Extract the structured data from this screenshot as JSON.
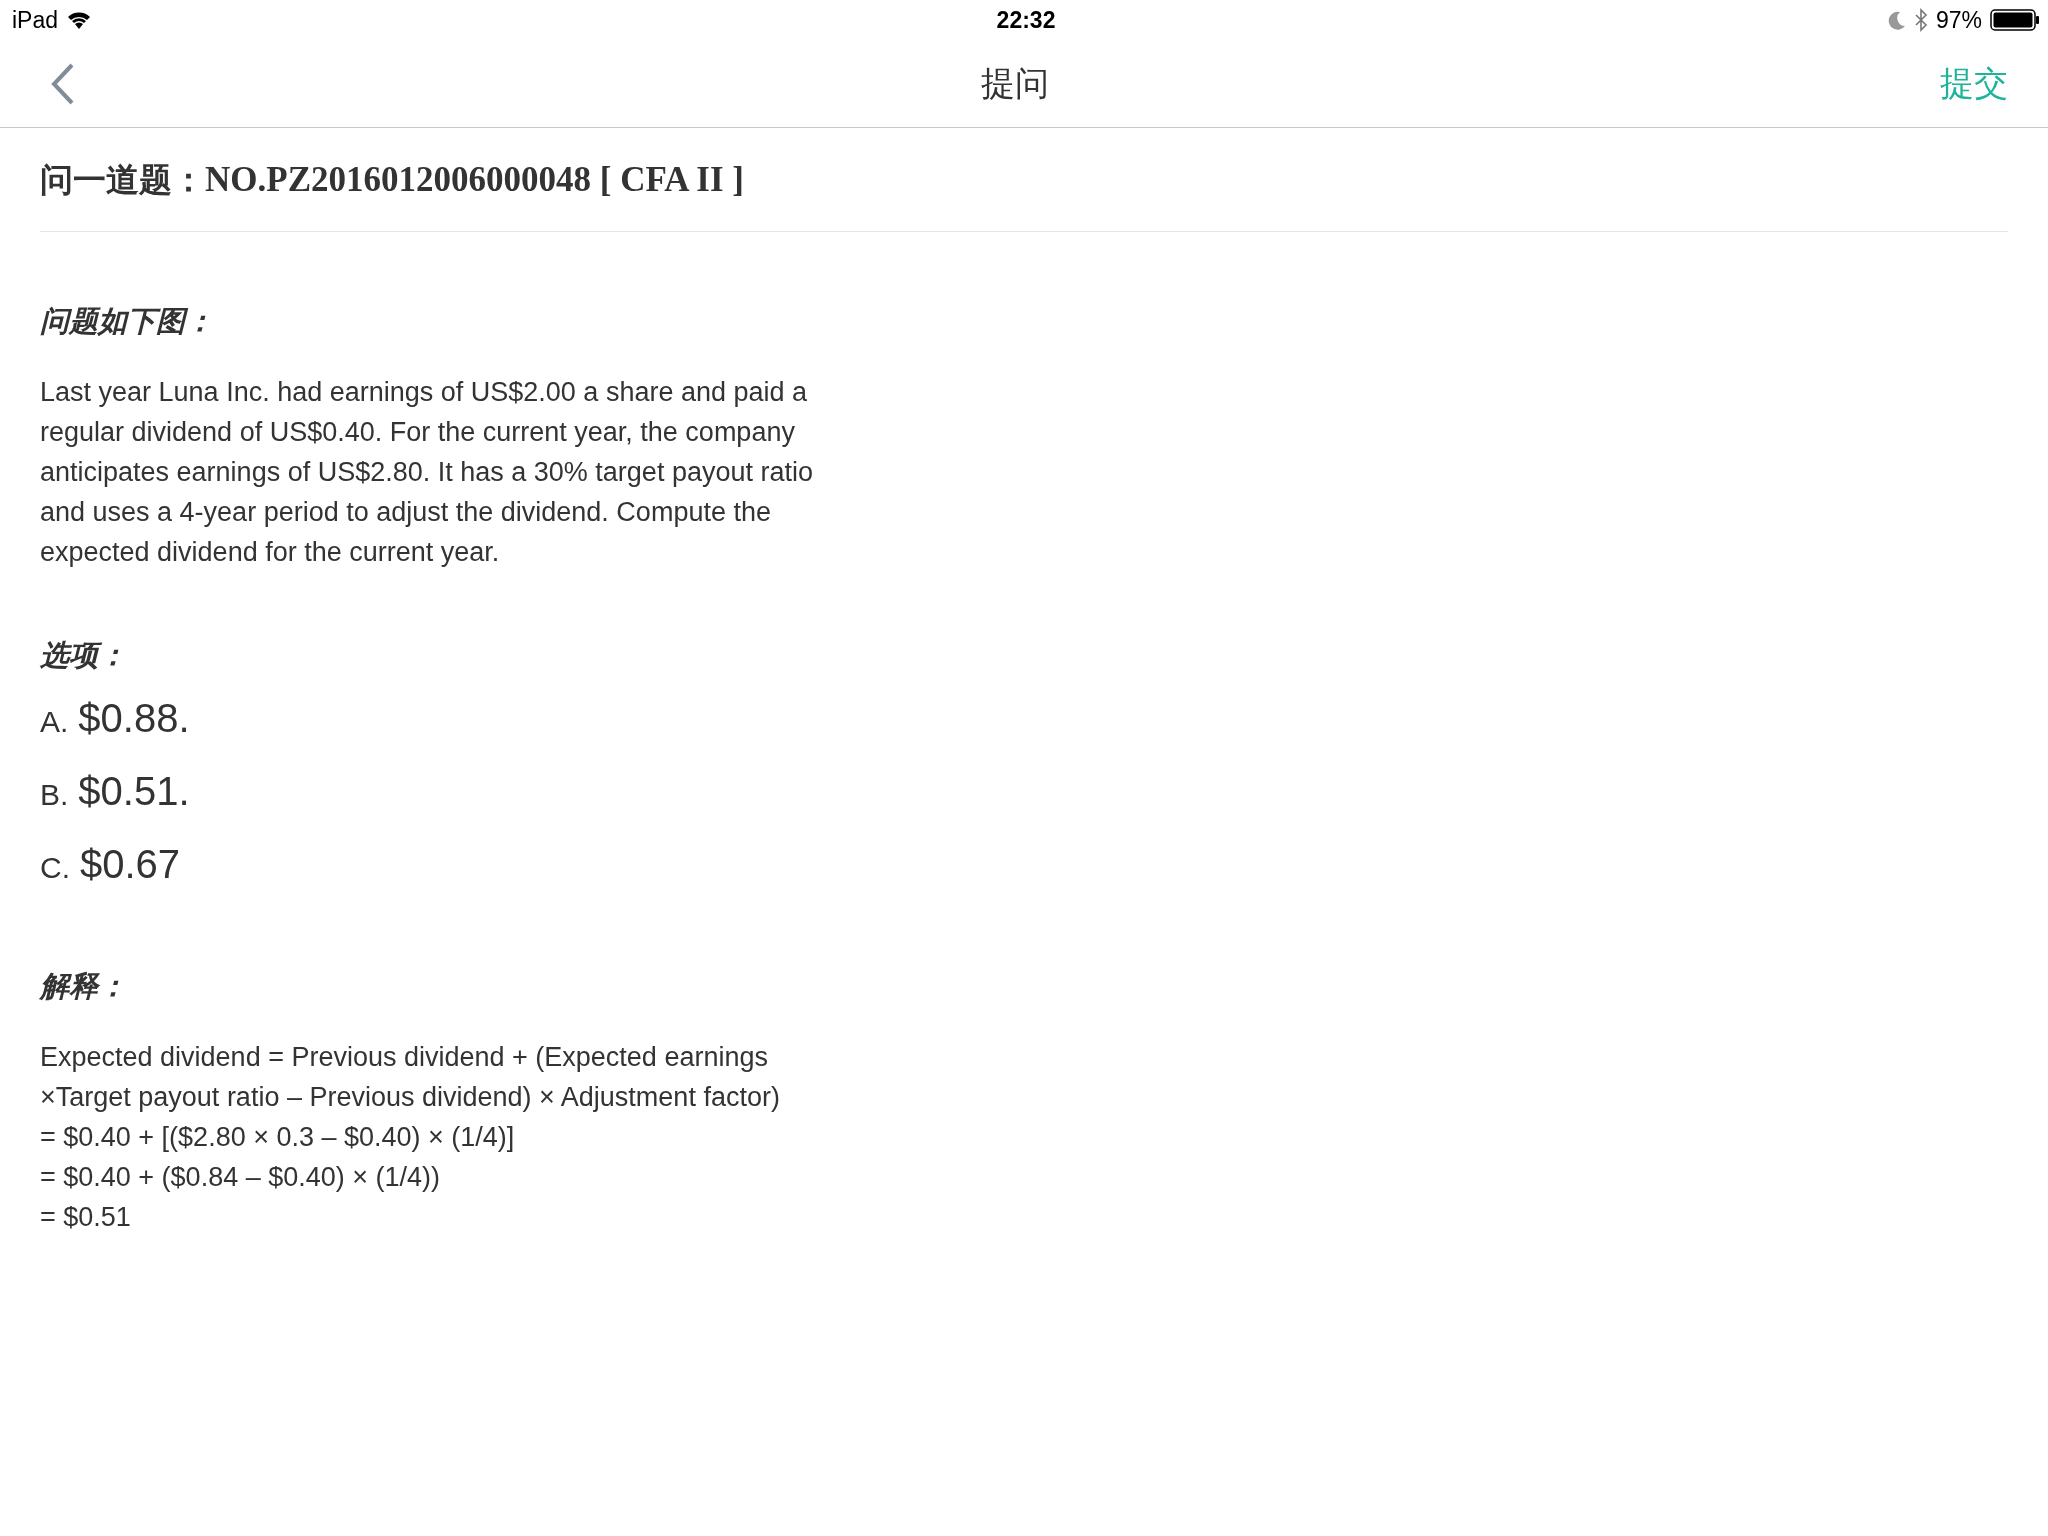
{
  "status_bar": {
    "device": "iPad",
    "time": "22:32",
    "battery": "97%"
  },
  "nav": {
    "title": "提问",
    "action": "提交"
  },
  "question_header": {
    "label": "问一道题：",
    "code": "NO.PZ2016012006000048 [ CFA II ]"
  },
  "question": {
    "heading": "问题如下图：",
    "lines": [
      "Last year Luna Inc. had earnings of US$2.00 a share and paid a",
      "regular dividend of US$0.40. For the current year, the company",
      "anticipates earnings of US$2.80. It has a 30% target payout ratio",
      "and uses a 4-year period to adjust the dividend. Compute the",
      "expected dividend for the current year."
    ]
  },
  "options": {
    "heading": "选项：",
    "items": [
      {
        "letter": "A.",
        "text": "$0.88."
      },
      {
        "letter": "B.",
        "text": "$0.51."
      },
      {
        "letter": "C.",
        "text": "$0.67"
      }
    ]
  },
  "explanation": {
    "heading": "解释：",
    "lines": [
      "Expected dividend = Previous dividend + (Expected earnings",
      "×Target payout ratio – Previous dividend) × Adjustment factor)",
      "= $0.40 + [($2.80 × 0.3 – $0.40) × (1/4)]",
      "= $0.40 + ($0.84 – $0.40) × (1/4))",
      "= $0.51"
    ]
  }
}
